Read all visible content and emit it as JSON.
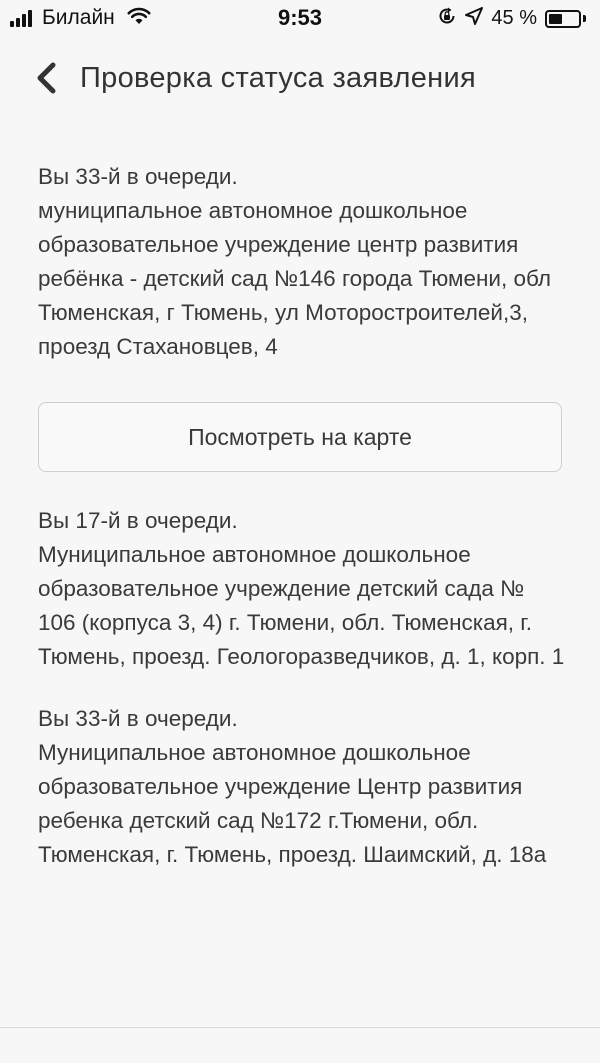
{
  "status_bar": {
    "carrier": "Билайн",
    "time": "9:53",
    "battery_percent": "45 %",
    "battery_level": 0.45,
    "icons": [
      "signal-icon",
      "wifi-icon",
      "orientation-lock-icon",
      "location-arrow-icon",
      "battery-icon"
    ]
  },
  "header": {
    "title": "Проверка статуса заявления",
    "back_icon": "chevron-left-icon"
  },
  "entries": [
    {
      "queue": "Вы 33-й в очереди.",
      "description": "муниципальное автономное дошкольное образовательное учреждение центр развития ребёнка - детский сад №146 города Тюмени, обл Тюменская, г Тюмень, ул Моторостроителей,3, проезд Стахановцев, 4"
    },
    {
      "queue": "Вы 17-й в очереди.",
      "description": "Муниципальное автономное дошкольное образовательное учреждение детский сада № 106 (корпуса 3, 4) г. Тюмени, обл. Тюменская, г. Тюмень, проезд. Геологоразведчиков, д. 1, корп. 1"
    },
    {
      "queue": "Вы 33-й в очереди.",
      "description": "Муниципальное автономное дошкольное образовательное учреждение Центр развития ребенка детский сад №172 г.Тюмени, обл. Тюменская, г. Тюмень, проезд. Шаимский, д. 18а"
    }
  ],
  "map_button": {
    "label": "Посмотреть на карте"
  }
}
